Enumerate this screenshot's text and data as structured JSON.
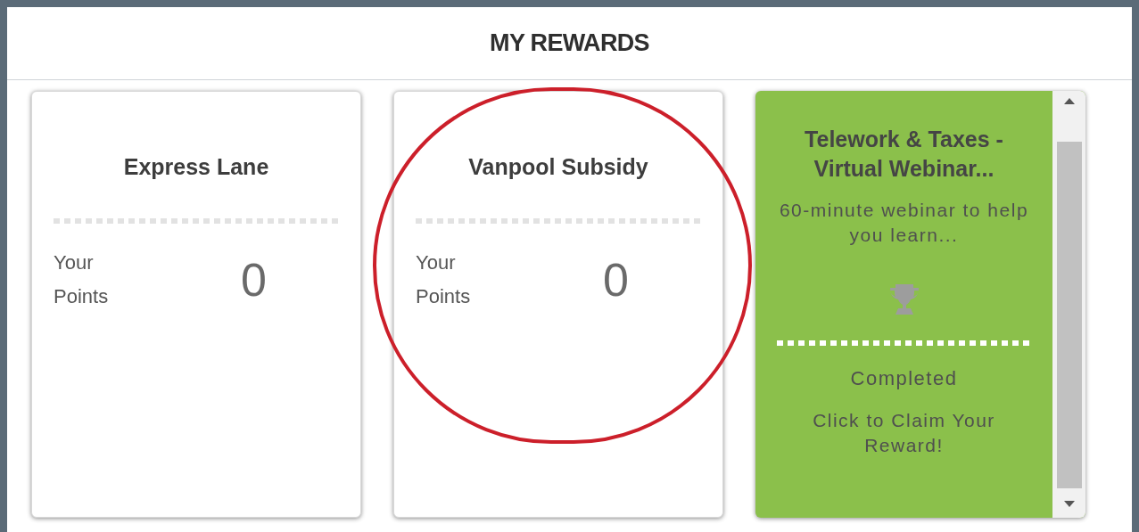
{
  "title": "MY REWARDS",
  "cards": [
    {
      "kind": "points",
      "title": "Express Lane",
      "points_label": "Your Points",
      "points": "0"
    },
    {
      "kind": "points",
      "title": "Vanpool Subsidy",
      "points_label": "Your Points",
      "points": "0"
    },
    {
      "kind": "completed",
      "title": "Telework & Taxes - Virtual Webinar...",
      "description": "60-minute webinar to help you learn...",
      "status": "Completed",
      "action": "Click to Claim Your Reward!"
    }
  ]
}
